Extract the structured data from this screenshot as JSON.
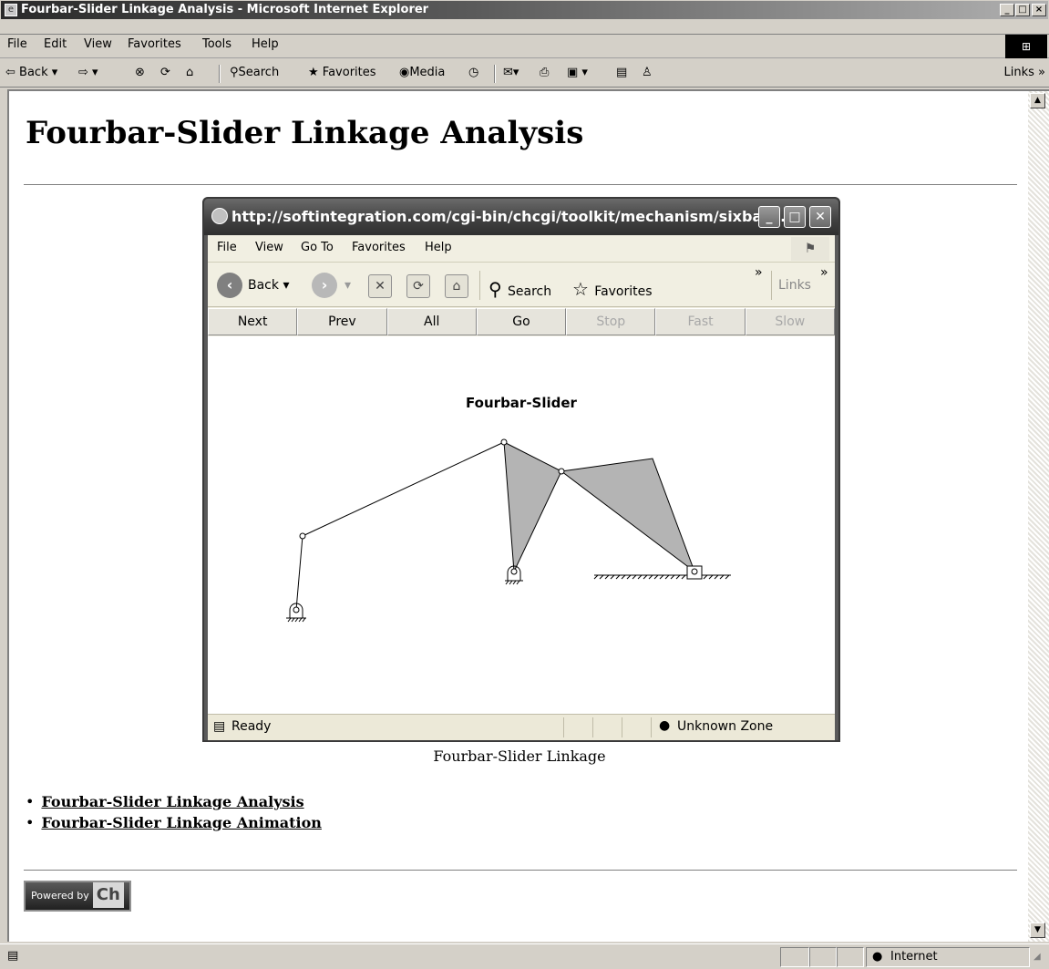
{
  "window": {
    "title": "Fourbar-Slider Linkage Analysis - Microsoft Internet Explorer",
    "controls": {
      "minimize": "_",
      "maximize": "□",
      "close": "×"
    }
  },
  "menubar": [
    "File",
    "Edit",
    "View",
    "Favorites",
    "Tools",
    "Help"
  ],
  "toolbar": {
    "back": "Back",
    "search": "Search",
    "favorites": "Favorites",
    "media": "Media",
    "links": "Links"
  },
  "page": {
    "heading": "Fourbar-Slider Linkage Analysis",
    "caption": "Fourbar-Slider Linkage",
    "links": [
      "Fourbar-Slider Linkage Analysis",
      "Fourbar-Slider Linkage Animation"
    ],
    "powered_by": "Powered by",
    "powered_logo": "Ch"
  },
  "inner_window": {
    "title": "http://softintegration.com/cgi-bin/chcgi/toolkit/mechanism/sixbar/...",
    "menu": [
      "File",
      "View",
      "Go To",
      "Favorites",
      "Help"
    ],
    "toolbar": {
      "back": "Back",
      "search": "Search",
      "favorites": "Favorites",
      "links": "Links"
    },
    "nav_buttons": [
      {
        "label": "Next",
        "enabled": true
      },
      {
        "label": "Prev",
        "enabled": true
      },
      {
        "label": "All",
        "enabled": true
      },
      {
        "label": "Go",
        "enabled": true
      },
      {
        "label": "Stop",
        "enabled": false
      },
      {
        "label": "Fast",
        "enabled": false
      },
      {
        "label": "Slow",
        "enabled": false
      }
    ],
    "diagram_title": "Fourbar-Slider",
    "status": {
      "left": "Ready",
      "zone": "Unknown Zone"
    }
  },
  "statusbar": {
    "zone": "Internet"
  },
  "colors": {
    "link_fill": "#b4b4b4",
    "link_stroke": "#000000"
  }
}
